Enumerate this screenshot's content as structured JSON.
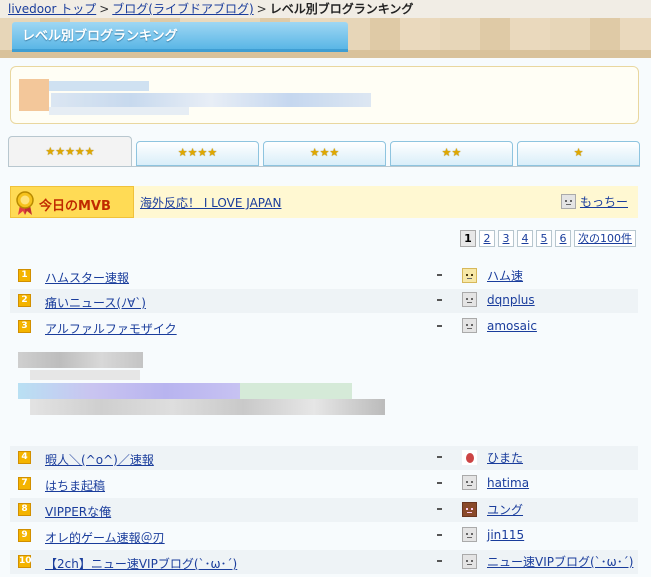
{
  "breadcrumb": {
    "home": "livedoor トップ",
    "sep": ">",
    "category": "ブログ(ライブドアブログ)",
    "current": "レベル別ブログランキング"
  },
  "page_title": "レベル別ブログランキング",
  "star_tabs": [
    {
      "label": "★★★★★",
      "active": true
    },
    {
      "label": "★★★★",
      "active": false
    },
    {
      "label": "★★★",
      "active": false
    },
    {
      "label": "★★",
      "active": false
    },
    {
      "label": "★",
      "active": false
    }
  ],
  "mvb": {
    "label": "今日のMVB",
    "blog": "海外反応！ I LOVE JAPAN",
    "user": "もっちー"
  },
  "pagination": {
    "pages": [
      "1",
      "2",
      "3",
      "4",
      "5",
      "6"
    ],
    "current": "1",
    "next": "次の100件"
  },
  "rankings_top": [
    {
      "rank": "1",
      "blog": "ハムスター速報",
      "user": "ハム速",
      "avatar": "hamster-avatar-icon"
    },
    {
      "rank": "2",
      "blog": "痛いニュース(ﾉ∀`)",
      "user": "dqnplus",
      "avatar": "default-avatar-icon"
    },
    {
      "rank": "3",
      "blog": "アルファルファモザイク",
      "user": "amosaic",
      "avatar": "default-avatar-icon"
    }
  ],
  "rankings_bottom": [
    {
      "rank": "4",
      "blog": "暇人＼(^o^)／速報",
      "user": "ひまた",
      "avatar": "red-avatar-icon"
    },
    {
      "rank": "7",
      "blog": "はちま起稿",
      "user": "hatima",
      "avatar": "default-avatar-icon"
    },
    {
      "rank": "8",
      "blog": "VIPPERな俺",
      "user": "ユング",
      "avatar": "girl-avatar-icon"
    },
    {
      "rank": "9",
      "blog": "オレ的ゲーム速報＠刃",
      "user": "jin115",
      "avatar": "default-avatar-icon"
    },
    {
      "rank": "10",
      "blog": "【2ch】ニュー速VIPブログ(`･ω･´)",
      "user": "ニュー速VIPブログ(`･ω･´)",
      "avatar": "default-avatar-icon"
    }
  ],
  "colors": {
    "accent": "#5ab6e6",
    "link": "#1a3d9c",
    "rank_badge": "#f4b400",
    "mvb_bg": "#ffdb55"
  }
}
